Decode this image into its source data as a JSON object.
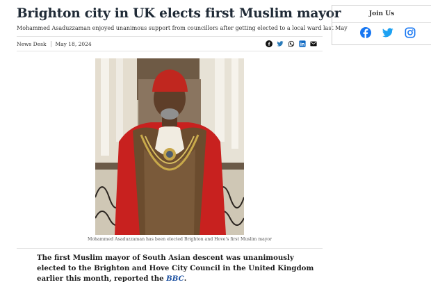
{
  "article": {
    "headline": "Brighton city in UK elects first Muslim mayor",
    "subtitle": "Mohammed Asaduzzaman enjoyed unanimous support from councillors after getting elected to a local ward last May",
    "author": "News Desk",
    "date": "May 18, 2024",
    "share_icons": [
      "facebook-icon",
      "twitter-icon",
      "whatsapp-icon",
      "linkedin-icon",
      "email-icon"
    ],
    "image_caption": "Mohammed Asaduzzaman has been elected Brighton and Hove's first Muslim mayor",
    "lead_text": "The first Muslim mayor of South Asian descent was unanimously elected to the Brighton and Hove City Council in the United Kingdom earlier this month, reported the ",
    "lead_link": "BBC",
    "lead_end": "."
  },
  "sidebar": {
    "title": "Join Us",
    "social_icons": [
      "facebook-icon",
      "twitter-icon",
      "instagram-icon"
    ]
  },
  "colors": {
    "headline": "#1f2a36",
    "link": "#1a4fa0",
    "facebook": "#1877f2",
    "twitter": "#1da1f2",
    "instagram": "#1877f2"
  }
}
